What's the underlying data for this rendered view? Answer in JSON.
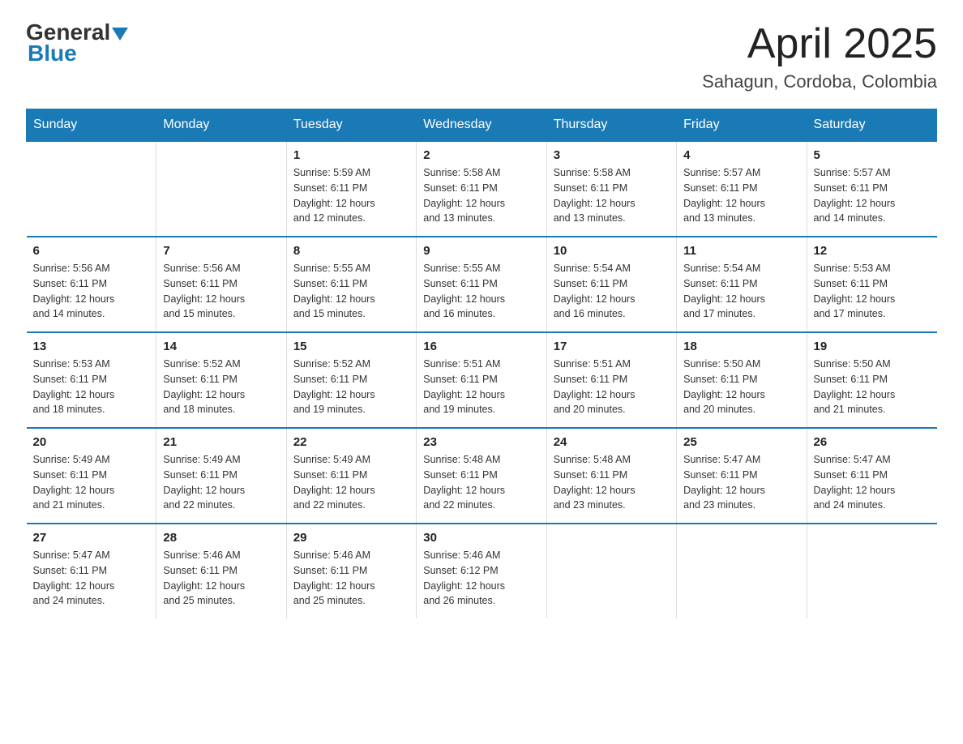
{
  "header": {
    "logo_general": "General",
    "logo_blue": "Blue",
    "month_title": "April 2025",
    "location": "Sahagun, Cordoba, Colombia"
  },
  "weekdays": [
    "Sunday",
    "Monday",
    "Tuesday",
    "Wednesday",
    "Thursday",
    "Friday",
    "Saturday"
  ],
  "weeks": [
    [
      {
        "day": "",
        "info": ""
      },
      {
        "day": "",
        "info": ""
      },
      {
        "day": "1",
        "info": "Sunrise: 5:59 AM\nSunset: 6:11 PM\nDaylight: 12 hours\nand 12 minutes."
      },
      {
        "day": "2",
        "info": "Sunrise: 5:58 AM\nSunset: 6:11 PM\nDaylight: 12 hours\nand 13 minutes."
      },
      {
        "day": "3",
        "info": "Sunrise: 5:58 AM\nSunset: 6:11 PM\nDaylight: 12 hours\nand 13 minutes."
      },
      {
        "day": "4",
        "info": "Sunrise: 5:57 AM\nSunset: 6:11 PM\nDaylight: 12 hours\nand 13 minutes."
      },
      {
        "day": "5",
        "info": "Sunrise: 5:57 AM\nSunset: 6:11 PM\nDaylight: 12 hours\nand 14 minutes."
      }
    ],
    [
      {
        "day": "6",
        "info": "Sunrise: 5:56 AM\nSunset: 6:11 PM\nDaylight: 12 hours\nand 14 minutes."
      },
      {
        "day": "7",
        "info": "Sunrise: 5:56 AM\nSunset: 6:11 PM\nDaylight: 12 hours\nand 15 minutes."
      },
      {
        "day": "8",
        "info": "Sunrise: 5:55 AM\nSunset: 6:11 PM\nDaylight: 12 hours\nand 15 minutes."
      },
      {
        "day": "9",
        "info": "Sunrise: 5:55 AM\nSunset: 6:11 PM\nDaylight: 12 hours\nand 16 minutes."
      },
      {
        "day": "10",
        "info": "Sunrise: 5:54 AM\nSunset: 6:11 PM\nDaylight: 12 hours\nand 16 minutes."
      },
      {
        "day": "11",
        "info": "Sunrise: 5:54 AM\nSunset: 6:11 PM\nDaylight: 12 hours\nand 17 minutes."
      },
      {
        "day": "12",
        "info": "Sunrise: 5:53 AM\nSunset: 6:11 PM\nDaylight: 12 hours\nand 17 minutes."
      }
    ],
    [
      {
        "day": "13",
        "info": "Sunrise: 5:53 AM\nSunset: 6:11 PM\nDaylight: 12 hours\nand 18 minutes."
      },
      {
        "day": "14",
        "info": "Sunrise: 5:52 AM\nSunset: 6:11 PM\nDaylight: 12 hours\nand 18 minutes."
      },
      {
        "day": "15",
        "info": "Sunrise: 5:52 AM\nSunset: 6:11 PM\nDaylight: 12 hours\nand 19 minutes."
      },
      {
        "day": "16",
        "info": "Sunrise: 5:51 AM\nSunset: 6:11 PM\nDaylight: 12 hours\nand 19 minutes."
      },
      {
        "day": "17",
        "info": "Sunrise: 5:51 AM\nSunset: 6:11 PM\nDaylight: 12 hours\nand 20 minutes."
      },
      {
        "day": "18",
        "info": "Sunrise: 5:50 AM\nSunset: 6:11 PM\nDaylight: 12 hours\nand 20 minutes."
      },
      {
        "day": "19",
        "info": "Sunrise: 5:50 AM\nSunset: 6:11 PM\nDaylight: 12 hours\nand 21 minutes."
      }
    ],
    [
      {
        "day": "20",
        "info": "Sunrise: 5:49 AM\nSunset: 6:11 PM\nDaylight: 12 hours\nand 21 minutes."
      },
      {
        "day": "21",
        "info": "Sunrise: 5:49 AM\nSunset: 6:11 PM\nDaylight: 12 hours\nand 22 minutes."
      },
      {
        "day": "22",
        "info": "Sunrise: 5:49 AM\nSunset: 6:11 PM\nDaylight: 12 hours\nand 22 minutes."
      },
      {
        "day": "23",
        "info": "Sunrise: 5:48 AM\nSunset: 6:11 PM\nDaylight: 12 hours\nand 22 minutes."
      },
      {
        "day": "24",
        "info": "Sunrise: 5:48 AM\nSunset: 6:11 PM\nDaylight: 12 hours\nand 23 minutes."
      },
      {
        "day": "25",
        "info": "Sunrise: 5:47 AM\nSunset: 6:11 PM\nDaylight: 12 hours\nand 23 minutes."
      },
      {
        "day": "26",
        "info": "Sunrise: 5:47 AM\nSunset: 6:11 PM\nDaylight: 12 hours\nand 24 minutes."
      }
    ],
    [
      {
        "day": "27",
        "info": "Sunrise: 5:47 AM\nSunset: 6:11 PM\nDaylight: 12 hours\nand 24 minutes."
      },
      {
        "day": "28",
        "info": "Sunrise: 5:46 AM\nSunset: 6:11 PM\nDaylight: 12 hours\nand 25 minutes."
      },
      {
        "day": "29",
        "info": "Sunrise: 5:46 AM\nSunset: 6:11 PM\nDaylight: 12 hours\nand 25 minutes."
      },
      {
        "day": "30",
        "info": "Sunrise: 5:46 AM\nSunset: 6:12 PM\nDaylight: 12 hours\nand 26 minutes."
      },
      {
        "day": "",
        "info": ""
      },
      {
        "day": "",
        "info": ""
      },
      {
        "day": "",
        "info": ""
      }
    ]
  ]
}
